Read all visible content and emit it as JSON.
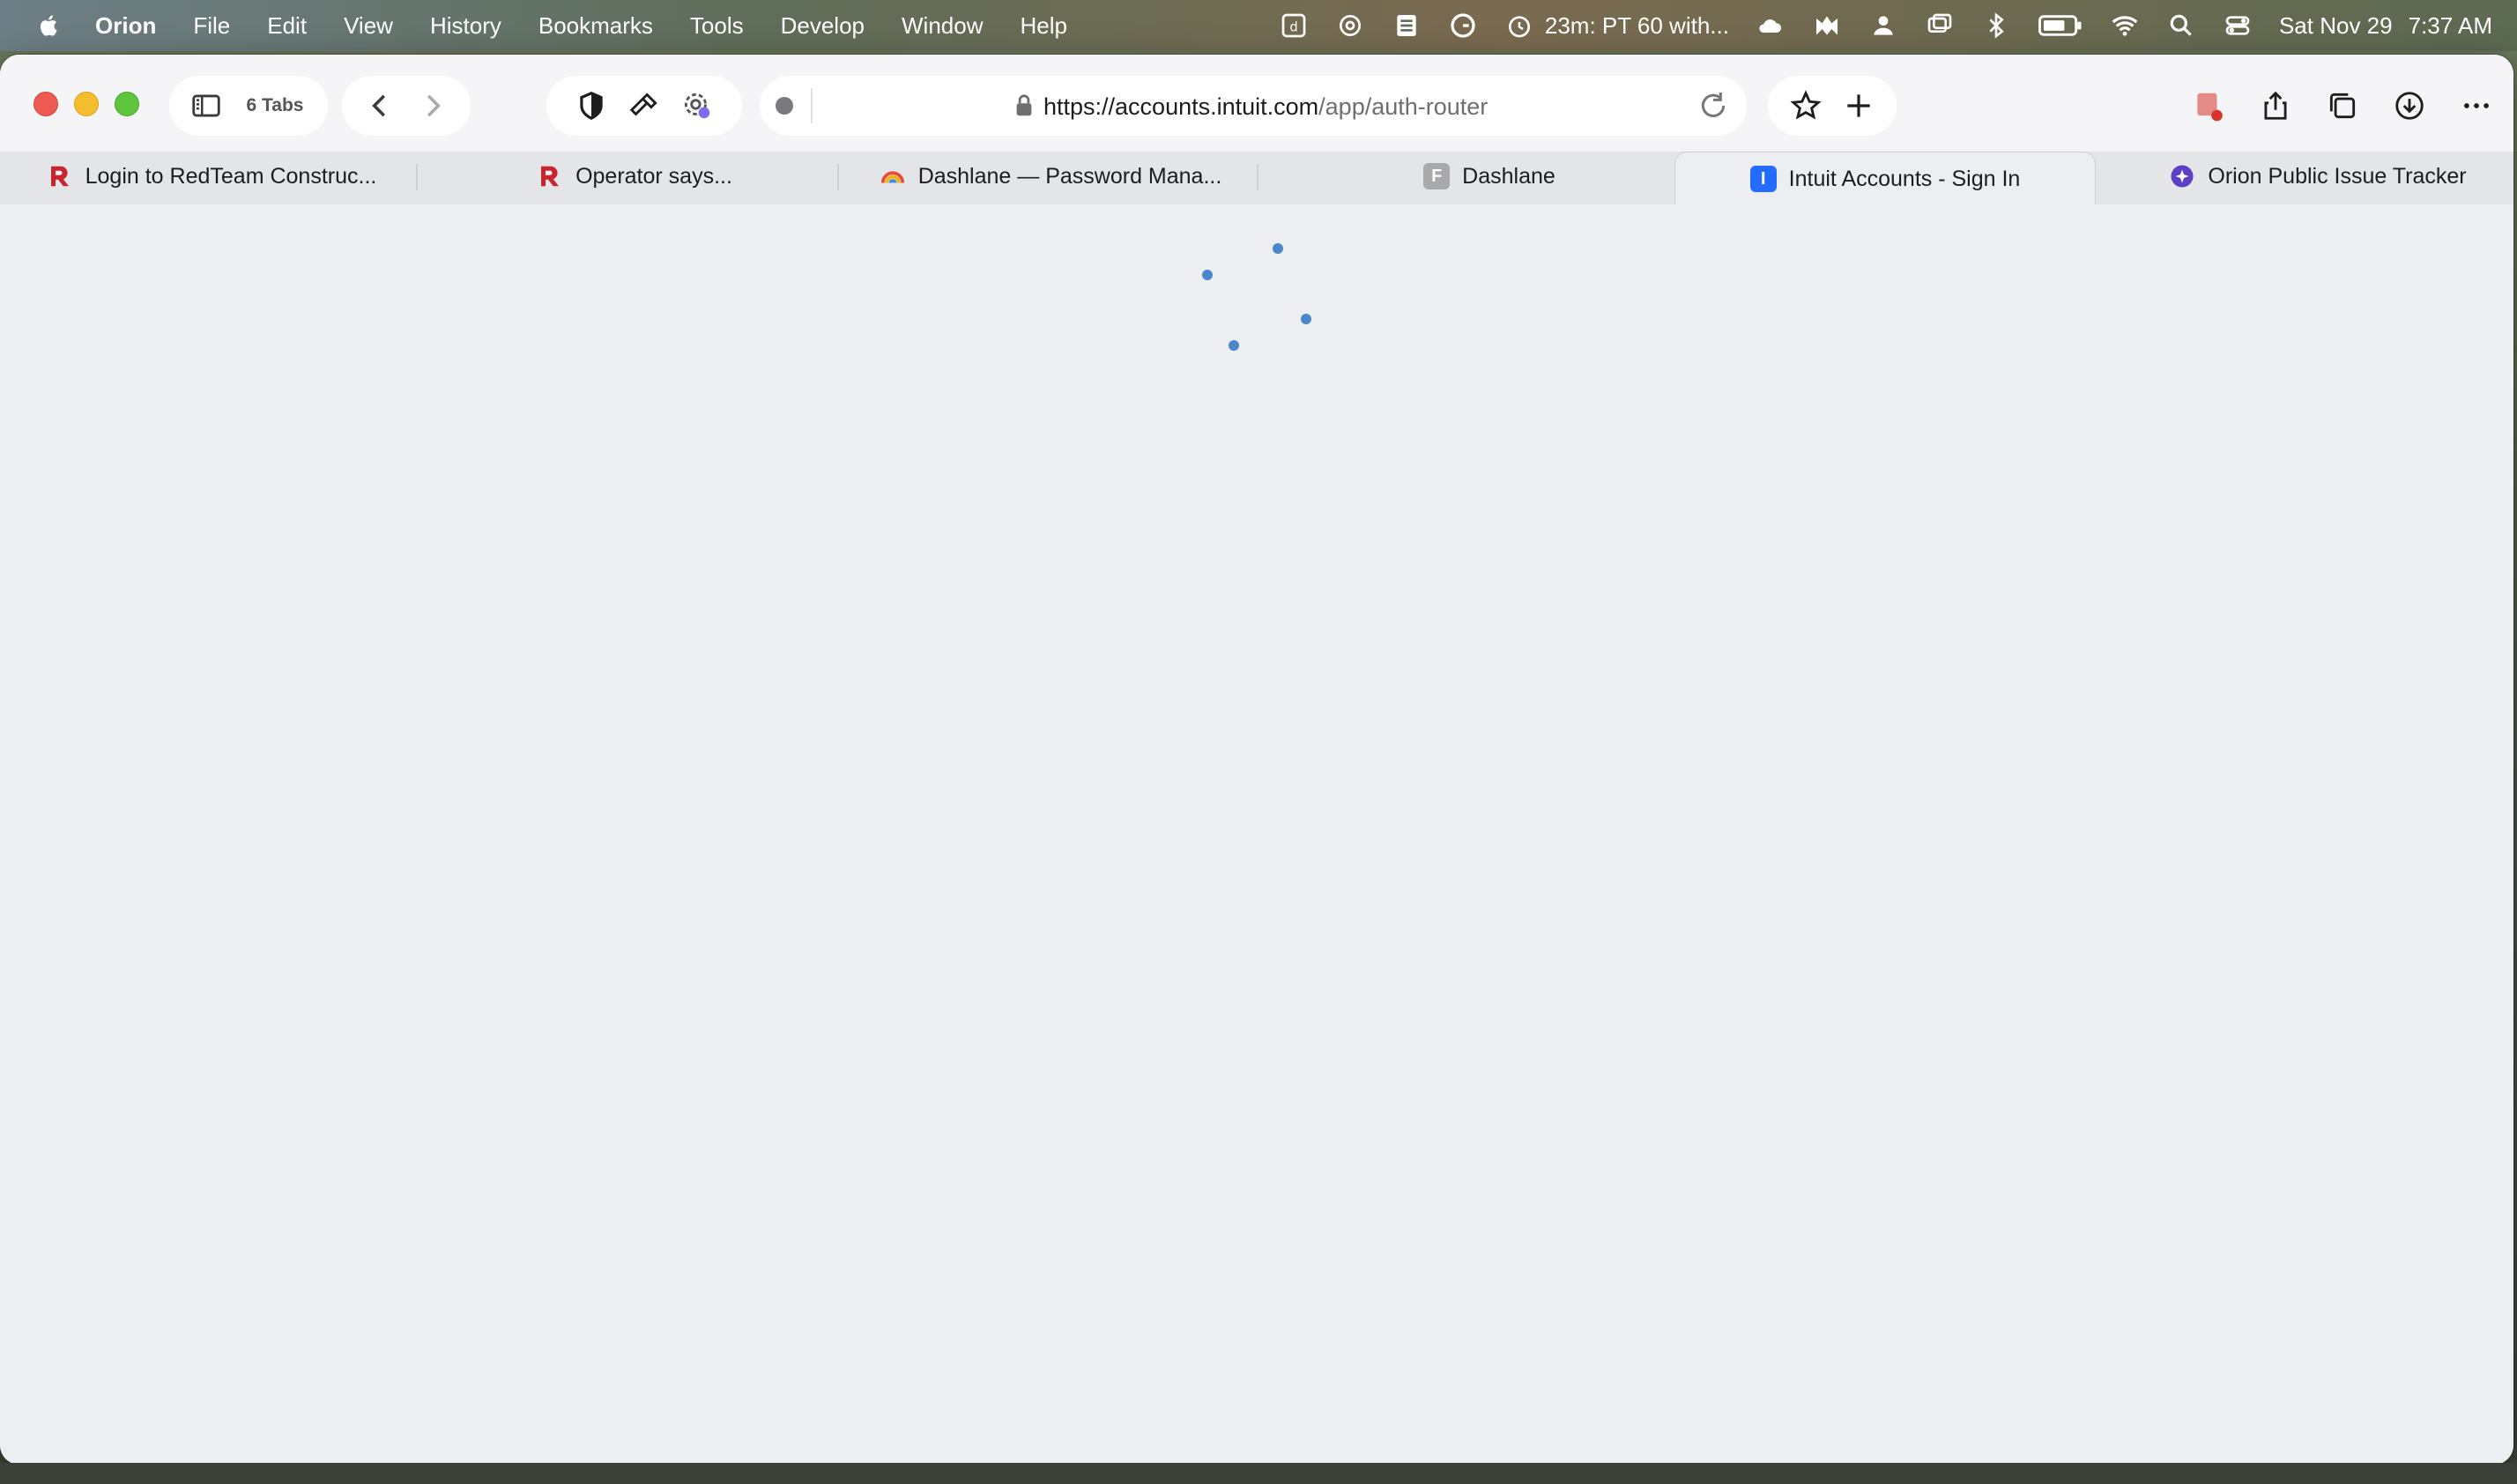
{
  "menubar": {
    "app_name": "Orion",
    "items": [
      "File",
      "Edit",
      "View",
      "History",
      "Bookmarks",
      "Tools",
      "Develop",
      "Window",
      "Help"
    ],
    "timer_text": "23m:  PT 60 with...",
    "date": "Sat Nov 29",
    "time": "7:37 AM"
  },
  "toolbar": {
    "tabs_count": "6 Tabs",
    "url_host": "https://accounts.intuit.com",
    "url_path": "/app/auth-router"
  },
  "tabs": [
    {
      "title": "Login to RedTeam Construc...",
      "favicon": "redteam-icon",
      "active": false
    },
    {
      "title": "Operator says...",
      "favicon": "redteam-icon",
      "active": false
    },
    {
      "title": "Dashlane — Password Mana...",
      "favicon": "rainbow-icon",
      "active": false
    },
    {
      "title": "Dashlane",
      "favicon_letter": "F",
      "active": false
    },
    {
      "title": "Intuit Accounts - Sign In",
      "favicon_letter": "I",
      "active": true
    },
    {
      "title": "Orion Public Issue Tracker",
      "favicon": "orion-icon",
      "active": false
    }
  ],
  "colors": {
    "spinner": "#4a86c8",
    "intuit_favicon": "#236cff",
    "redteam": "#c8252f"
  }
}
